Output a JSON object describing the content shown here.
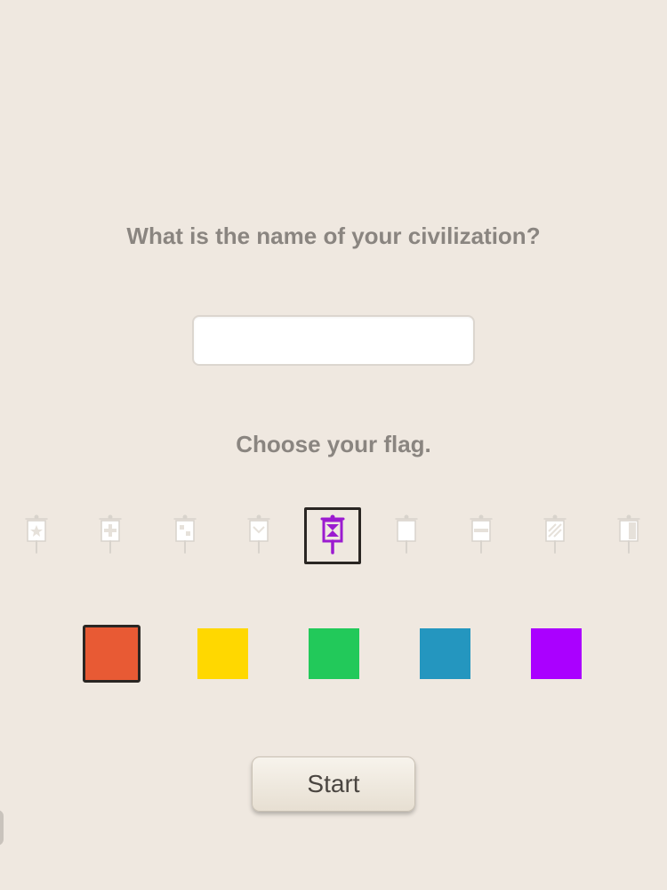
{
  "prompts": {
    "civ_name": "What is the name of your civilization?",
    "flag": "Choose your flag."
  },
  "name_input": {
    "value": "",
    "placeholder": ""
  },
  "flags": [
    {
      "icon": "flag-banner-star-icon",
      "selected": false
    },
    {
      "icon": "flag-banner-cross-icon",
      "selected": false
    },
    {
      "icon": "flag-banner-grid-icon",
      "selected": false
    },
    {
      "icon": "flag-banner-chevron-icon",
      "selected": false
    },
    {
      "icon": "flag-banner-hourglass-icon",
      "selected": true
    },
    {
      "icon": "flag-banner-plain-icon",
      "selected": false
    },
    {
      "icon": "flag-banner-stripe-icon",
      "selected": false
    },
    {
      "icon": "flag-banner-diagonal-icon",
      "selected": false
    },
    {
      "icon": "flag-banner-half-icon",
      "selected": false
    }
  ],
  "colors": [
    {
      "name": "red",
      "hex": "#e85a34",
      "selected": true
    },
    {
      "name": "yellow",
      "hex": "#ffd800",
      "selected": false
    },
    {
      "name": "green",
      "hex": "#22c95a",
      "selected": false
    },
    {
      "name": "blue",
      "hex": "#2496bf",
      "selected": false
    },
    {
      "name": "purple",
      "hex": "#aa00ff",
      "selected": false
    }
  ],
  "theme": {
    "background": "#efe8e0",
    "selected_flag_color": "#9b1bd0",
    "unselected_flag_color": "#ffffff"
  },
  "start_label": "Start"
}
